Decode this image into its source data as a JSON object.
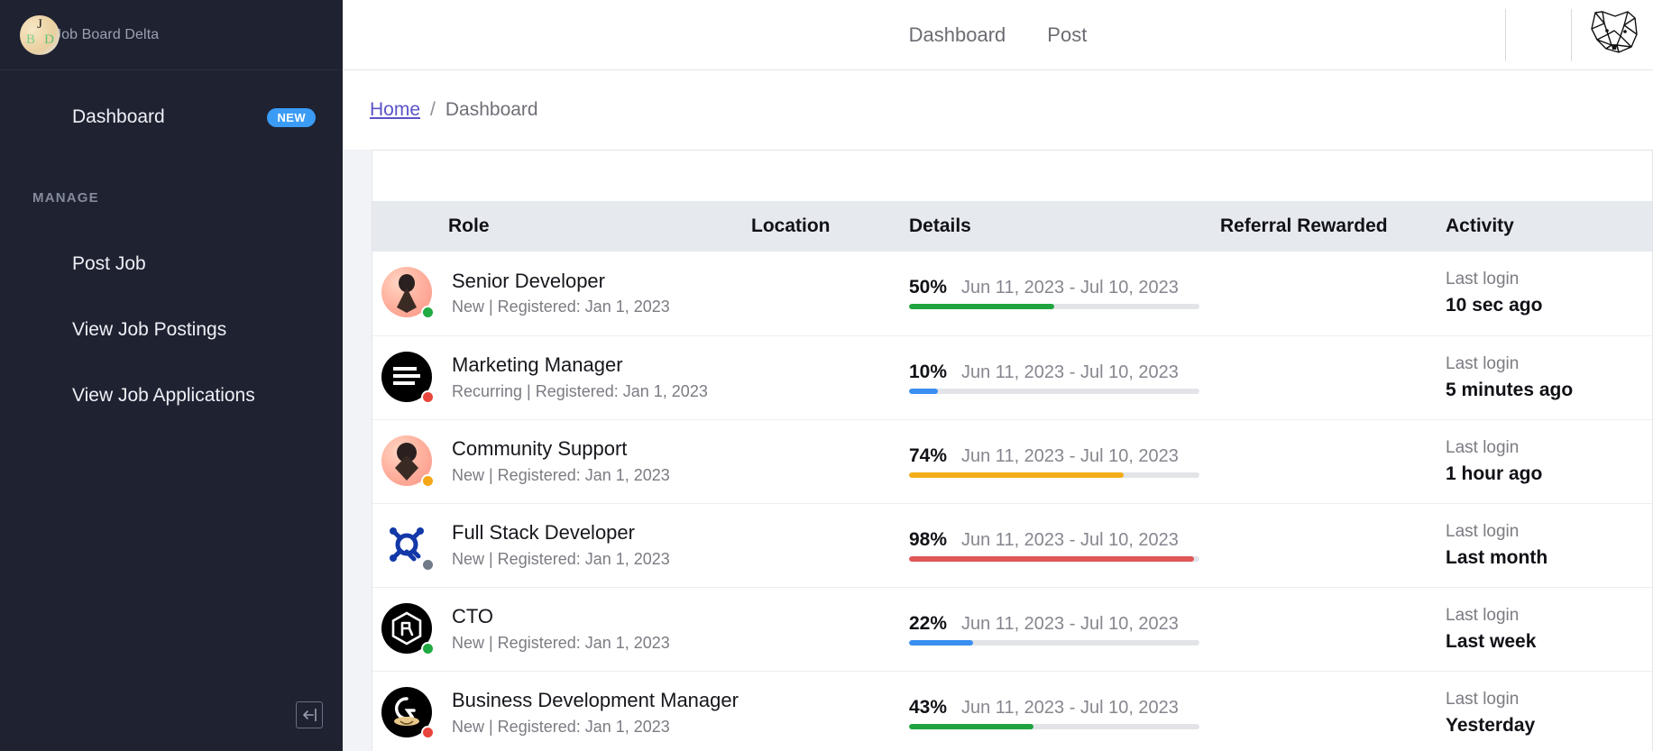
{
  "sidebar": {
    "brand": {
      "name": "Job Board Delta",
      "logo_letters": {
        "top": "J",
        "left": "B",
        "right": "D"
      }
    },
    "primary": [
      {
        "label": "Dashboard",
        "badge": "NEW"
      }
    ],
    "section_label": "MANAGE",
    "items": [
      {
        "label": "Post Job"
      },
      {
        "label": "View Job Postings"
      },
      {
        "label": "View Job Applications"
      }
    ],
    "collapse_icon": "collapse-sidebar-icon"
  },
  "topbar": {
    "nav": [
      {
        "label": "Dashboard"
      },
      {
        "label": "Post"
      }
    ],
    "avatar_icon": "fox-avatar-icon"
  },
  "breadcrumb": {
    "home": "Home",
    "separator": "/",
    "current": "Dashboard"
  },
  "table": {
    "headers": {
      "role": "Role",
      "location": "Location",
      "details": "Details",
      "referral": "Referral Rewarded",
      "activity": "Activity"
    },
    "rows": [
      {
        "role": "Senior Developer",
        "sub": "New | Registered: Jan 1, 2023",
        "location": "",
        "percent": "50%",
        "progress": 50,
        "bar_color": "#21a43f",
        "range": "Jun 11, 2023 - Jul 10, 2023",
        "referral": "",
        "activity_label": "Last login",
        "activity_value": "10 sec ago",
        "avatar_kind": "pink-person",
        "status": "green"
      },
      {
        "role": "Marketing Manager",
        "sub": "Recurring | Registered: Jan 1, 2023",
        "location": "",
        "percent": "10%",
        "progress": 10,
        "bar_color": "#3b8ff0",
        "range": "Jun 11, 2023 - Jul 10, 2023",
        "referral": "",
        "activity_label": "Last login",
        "activity_value": "5 minutes ago",
        "avatar_kind": "black-lines",
        "status": "red"
      },
      {
        "role": "Community Support",
        "sub": "New | Registered: Jan 1, 2023",
        "location": "",
        "percent": "74%",
        "progress": 74,
        "bar_color": "#f4ad18",
        "range": "Jun 11, 2023 - Jul 10, 2023",
        "referral": "",
        "activity_label": "Last login",
        "activity_value": "1 hour ago",
        "avatar_kind": "pink-pin",
        "status": "yellow"
      },
      {
        "role": "Full Stack Developer",
        "sub": "New | Registered: Jan 1, 2023",
        "location": "",
        "percent": "98%",
        "progress": 98,
        "bar_color": "#e05757",
        "range": "Jun 11, 2023 - Jul 10, 2023",
        "referral": "",
        "activity_label": "Last login",
        "activity_value": "Last month",
        "avatar_kind": "blue-q",
        "status": "gray"
      },
      {
        "role": "CTO",
        "sub": "New | Registered: Jan 1, 2023",
        "location": "",
        "percent": "22%",
        "progress": 22,
        "bar_color": "#3b8ff0",
        "range": "Jun 11, 2023 - Jul 10, 2023",
        "referral": "",
        "activity_label": "Last login",
        "activity_value": "Last week",
        "avatar_kind": "black-hex",
        "status": "green"
      },
      {
        "role": "Business Development Manager",
        "sub": "New | Registered: Jan 1, 2023",
        "location": "",
        "percent": "43%",
        "progress": 43,
        "bar_color": "#21a43f",
        "range": "Jun 11, 2023 - Jul 10, 2023",
        "referral": "",
        "activity_label": "Last login",
        "activity_value": "Yesterday",
        "avatar_kind": "black-face",
        "status": "red"
      }
    ]
  },
  "colors": {
    "sidebar_bg": "#1e2231",
    "badge_blue": "#3b9cf6",
    "link_purple": "#5b53c9",
    "table_header_bg": "#e6e9ee",
    "content_bg": "#f1f3f6"
  }
}
